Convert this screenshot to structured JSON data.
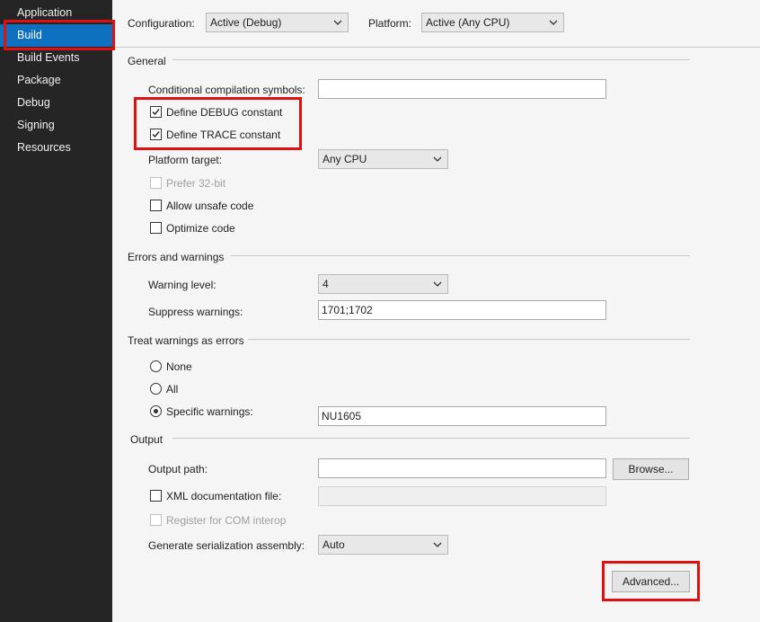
{
  "sidebar": {
    "items": [
      {
        "label": "Application"
      },
      {
        "label": "Build",
        "active": true
      },
      {
        "label": "Build Events"
      },
      {
        "label": "Package"
      },
      {
        "label": "Debug"
      },
      {
        "label": "Signing"
      },
      {
        "label": "Resources"
      }
    ]
  },
  "top": {
    "configuration_label": "Configuration:",
    "configuration_value": "Active (Debug)",
    "platform_label": "Platform:",
    "platform_value": "Active (Any CPU)"
  },
  "general": {
    "header": "General",
    "cond_symbols_label": "Conditional compilation symbols:",
    "cond_symbols_value": "",
    "define_debug_label": "Define DEBUG constant",
    "define_debug_checked": true,
    "define_trace_label": "Define TRACE constant",
    "define_trace_checked": true,
    "platform_target_label": "Platform target:",
    "platform_target_value": "Any CPU",
    "prefer32_label": "Prefer 32-bit",
    "unsafe_label": "Allow unsafe code",
    "optimize_label": "Optimize code"
  },
  "errors": {
    "header": "Errors and warnings",
    "warning_level_label": "Warning level:",
    "warning_level_value": "4",
    "suppress_label": "Suppress warnings:",
    "suppress_value": "1701;1702"
  },
  "treat": {
    "header": "Treat warnings as errors",
    "none_label": "None",
    "all_label": "All",
    "specific_label": "Specific warnings:",
    "specific_value": "NU1605",
    "selected": "specific"
  },
  "output": {
    "header": "Output",
    "path_label": "Output path:",
    "path_value": "",
    "browse_label": "Browse...",
    "xml_label": "XML documentation file:",
    "xml_value": "",
    "com_label": "Register for COM interop",
    "serialization_label": "Generate serialization assembly:",
    "serialization_value": "Auto",
    "advanced_label": "Advanced..."
  },
  "colors": {
    "sidebar_bg": "#252526",
    "active_item": "#0e70c0",
    "highlight_box": "#e01010"
  }
}
